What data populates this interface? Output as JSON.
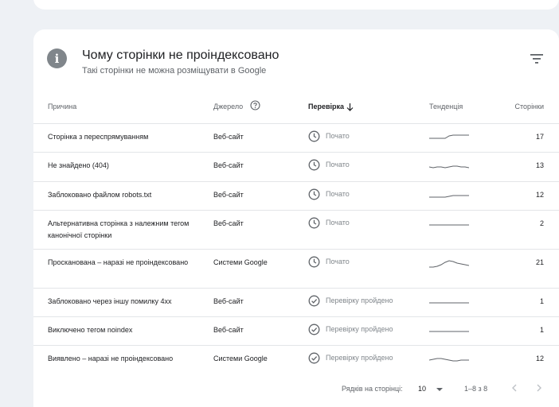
{
  "header": {
    "title": "Чому сторінки не проіндексовано",
    "subtitle": "Такі сторінки не можна розміщувати в Google"
  },
  "table": {
    "columns": {
      "cause": "Причина",
      "source": "Джерело",
      "validation": "Перевірка",
      "trend": "Тенденція",
      "pages": "Сторінки"
    },
    "rows": [
      {
        "cause": "Сторінка з переспрямуванням",
        "source": "Веб-сайт",
        "status": "Почато",
        "status_type": "started",
        "pages": "17",
        "trend": [
          8,
          8,
          8,
          8,
          8,
          5,
          4,
          4,
          4,
          4,
          4
        ]
      },
      {
        "cause": "Не знайдено (404)",
        "source": "Веб-сайт",
        "status": "Почато",
        "status_type": "started",
        "pages": "13",
        "trend": [
          8,
          9,
          8,
          8,
          9,
          8,
          7,
          7,
          8,
          8,
          9
        ]
      },
      {
        "cause": "Заблоковано файлом robots.txt",
        "source": "Веб-сайт",
        "status": "Почато",
        "status_type": "started",
        "pages": "12",
        "trend": [
          9,
          9,
          9,
          9,
          9,
          8,
          7,
          7,
          7,
          7,
          7
        ]
      },
      {
        "cause": "Альтернативна сторінка з належним тегом канонічної сторінки",
        "source": "Веб-сайт",
        "status": "Почато",
        "status_type": "started",
        "pages": "2",
        "trend": [
          8,
          8,
          8,
          8,
          8,
          8,
          8,
          8,
          8,
          8,
          8
        ]
      },
      {
        "cause": "Просканована – наразі не проіндексовано",
        "source": "Системи Google",
        "status": "Почато",
        "status_type": "started",
        "pages": "21",
        "trend": [
          12,
          12,
          11,
          9,
          6,
          4,
          5,
          7,
          8,
          9,
          10
        ]
      },
      {
        "cause": "Заблоковано через іншу помилку 4xx",
        "source": "Веб-сайт",
        "status": "Перевірку пройдено",
        "status_type": "passed",
        "pages": "1",
        "trend": [
          8,
          8,
          8,
          8,
          8,
          8,
          8,
          8,
          8,
          8,
          8
        ]
      },
      {
        "cause": "Виключено тегом noindex",
        "source": "Веб-сайт",
        "status": "Перевірку пройдено",
        "status_type": "passed",
        "pages": "1",
        "trend": [
          8,
          8,
          8,
          8,
          8,
          8,
          8,
          8,
          8,
          8,
          8
        ]
      },
      {
        "cause": "Виявлено – наразі не проіндексовано",
        "source": "Системи Google",
        "status": "Перевірку пройдено",
        "status_type": "passed",
        "pages": "12",
        "trend": [
          8,
          7,
          6,
          6,
          7,
          8,
          9,
          9,
          8,
          8,
          8
        ]
      }
    ]
  },
  "pagination": {
    "rows_label": "Рядків на сторінці:",
    "rows_value": "10",
    "range": "1–8 з 8"
  },
  "colors": {
    "accent_icon": "#80868b",
    "trend_line": "#5f6368"
  },
  "icons": {
    "info": "info-icon",
    "filter": "filter-icon",
    "help": "help-circle-icon",
    "sort": "arrow-down-icon",
    "started": "clock-icon",
    "passed": "check-circle-icon"
  }
}
